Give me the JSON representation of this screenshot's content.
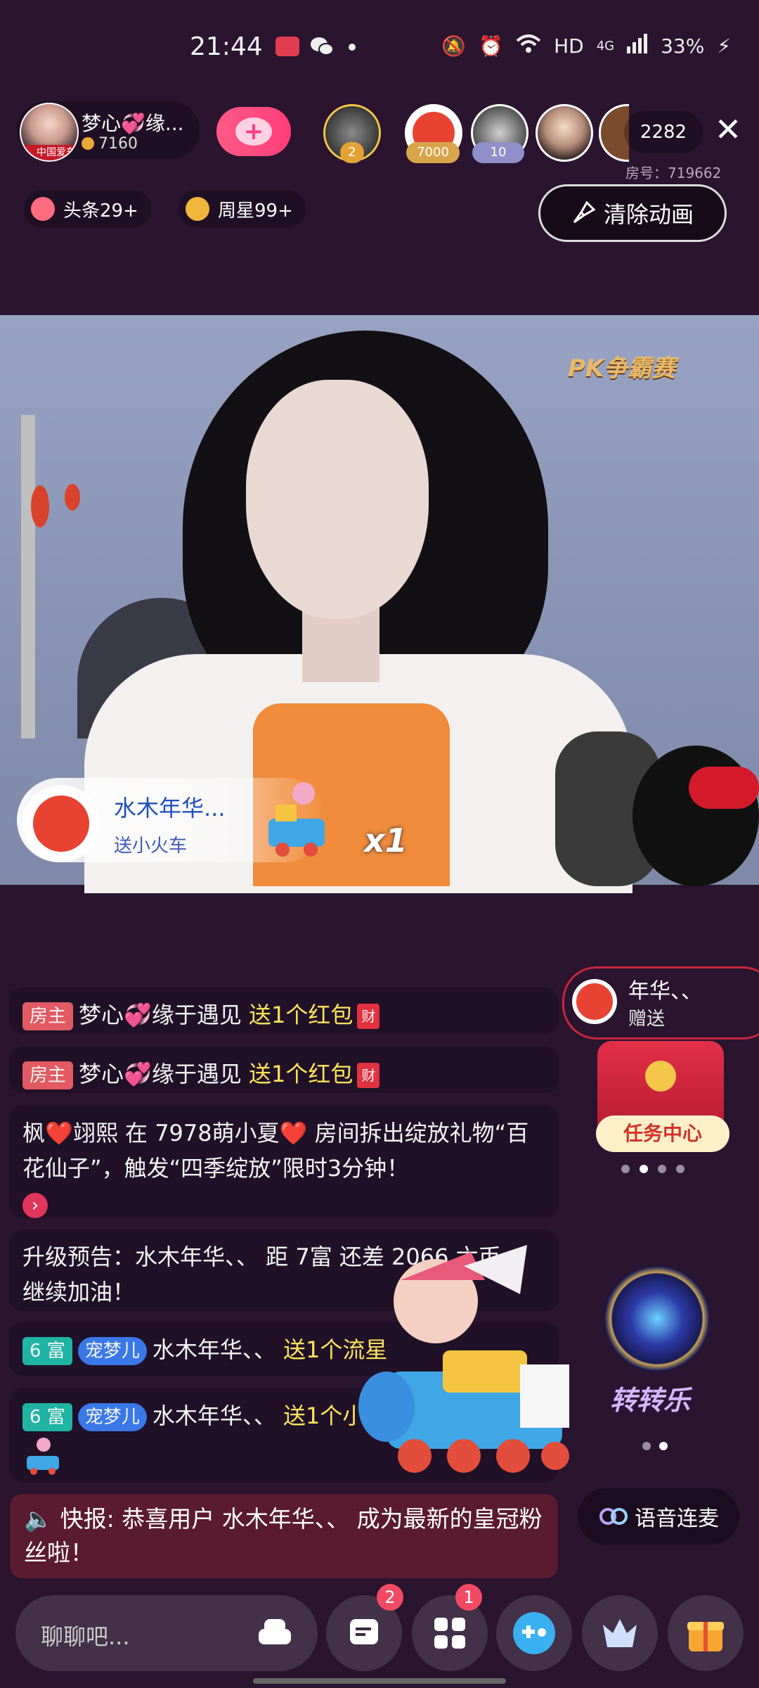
{
  "status_bar": {
    "time": "21:44",
    "network": "HD",
    "signal": "4G",
    "battery": "33%"
  },
  "host": {
    "name": "梦心💞缘...",
    "coins": "7160",
    "avatar_tag": "中国爱车"
  },
  "top_viewers": {
    "badges": [
      "2",
      "7000",
      "10"
    ],
    "count": "2282",
    "room_no": "房号：719662"
  },
  "chips": [
    {
      "label": "头条29+"
    },
    {
      "label": "周星99+"
    }
  ],
  "clear_animation_label": "清除动画",
  "video_logo": "PK争霸赛",
  "gift_notice": {
    "name": "水木年华...",
    "desc": "送小火车",
    "multiplier": "x1"
  },
  "chat": [
    {
      "tag": "房主",
      "user": "梦心💞缘于遇见",
      "action": "送1个红包",
      "icon": "财"
    },
    {
      "tag": "房主",
      "user": "梦心💞缘于遇见",
      "action": "送1个红包",
      "icon": "财"
    },
    {
      "text": "枫❤️翊熙 在 7978萌小夏❤️ 房间拆出绽放礼物“百花仙子”，触发“四季绽放”限时3分钟！"
    },
    {
      "text": "升级预告：水木年华、、 距 7富 还差 2066 六币，继续加油！"
    },
    {
      "tag": "6 富",
      "fan": "宠梦儿",
      "user": "水木年华、、",
      "action": "送1个流星"
    },
    {
      "tag": "6 富",
      "fan": "宠梦儿",
      "user": "水木年华、、",
      "action": "送1个小火车"
    }
  ],
  "flash_news": "快报: 恭喜用户 水木年华、、 成为最新的皇冠粉丝啦！",
  "sender_pill": {
    "name": "年华、、",
    "desc": "赠送"
  },
  "task_center_label": "任务中心",
  "wheel_label": "转转乐",
  "voice_link_label": "语音连麦",
  "input_placeholder": "聊聊吧...",
  "bottom_badges": {
    "message": "2",
    "apps": "1"
  },
  "colors": {
    "background": "#2a1430",
    "accent_pink": "#ff3d7a",
    "highlight": "#ffe55a",
    "host_tag": "#e25a62",
    "rich_tag": "#1fb4a4"
  }
}
